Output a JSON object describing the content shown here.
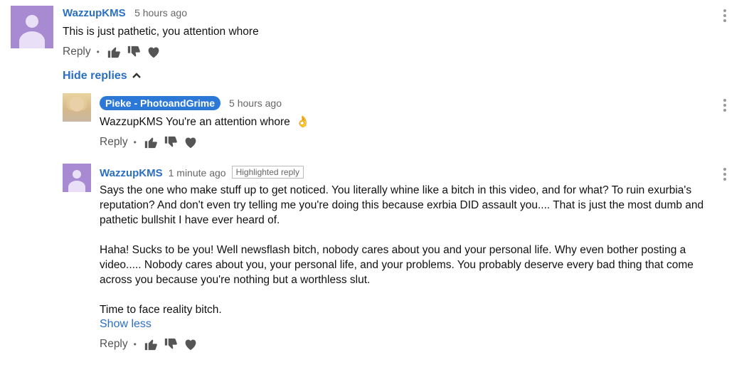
{
  "comments": [
    {
      "author": "WazzupKMS",
      "time": "5 hours ago",
      "text": "This is just pathetic, you attention whore",
      "reply": "Reply",
      "dot": "•"
    }
  ],
  "hide_replies": "Hide replies",
  "replies": [
    {
      "author": "Pieke - PhotoandGrime",
      "time": "5 hours ago",
      "text": "WazzupKMS You're an attention whore",
      "emoji": "👌",
      "reply": "Reply",
      "dot": "•"
    },
    {
      "author": "WazzupKMS",
      "time": "1 minute ago",
      "badge": "Highlighted reply",
      "paragraphs": [
        "Says the one who make stuff up to get noticed. You literally whine like a bitch in this video, and for what? To ruin exurbia's reputation? And don't even try telling me you're doing this because exrbia DID assault you.... That is just the most dumb and pathetic bullshit I have ever heard of.",
        "Haha! Sucks to be you! Well newsflash bitch, nobody cares about you and your personal life. Why  even bother posting a video..... Nobody cares about you, your personal life, and your problems. You probably deserve every bad thing that come across you because you're nothing but a worthless slut.",
        "Time to face reality bitch."
      ],
      "show_less": "Show less",
      "reply": "Reply",
      "dot": "•"
    }
  ],
  "colors": {
    "author_link": "#2b6fc2",
    "avatar_purple": "#a88ad3",
    "creator_badge": "#2b78d6"
  },
  "icons": {
    "thumbs_up": "thumbs-up-icon",
    "thumbs_down": "thumbs-down-icon",
    "heart": "heart-icon",
    "more": "more-vert-icon",
    "chevron": "chevron-up-icon"
  }
}
